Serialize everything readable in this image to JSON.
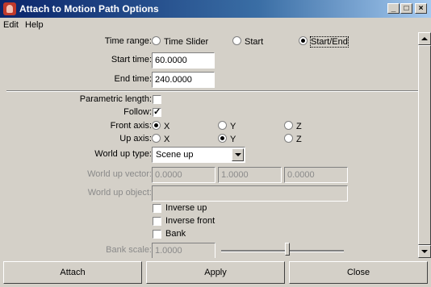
{
  "window": {
    "title": "Attach to Motion Path Options",
    "min_label": "_",
    "max_label": "□",
    "close_label": "×"
  },
  "menu": {
    "edit": "Edit",
    "help": "Help"
  },
  "time_range": {
    "label": "Time range:",
    "options": [
      "Time Slider",
      "Start",
      "Start/End"
    ],
    "selected": "Start/End"
  },
  "start_time": {
    "label": "Start time:",
    "value": "60.0000"
  },
  "end_time": {
    "label": "End time:",
    "value": "240.0000"
  },
  "parametric_length": {
    "label": "Parametric length:",
    "checked": false
  },
  "follow": {
    "label": "Follow:",
    "checked": true
  },
  "front_axis": {
    "label": "Front axis:",
    "options": [
      "X",
      "Y",
      "Z"
    ],
    "selected": "X"
  },
  "up_axis": {
    "label": "Up axis:",
    "options": [
      "X",
      "Y",
      "Z"
    ],
    "selected": "Y"
  },
  "world_up_type": {
    "label": "World up type:",
    "value": "Scene up"
  },
  "world_up_vector": {
    "label": "World up vector:",
    "values": [
      "0.0000",
      "1.0000",
      "0.0000"
    ]
  },
  "world_up_object": {
    "label": "World up object:",
    "value": ""
  },
  "inverse_up": {
    "label": "Inverse up",
    "checked": false
  },
  "inverse_front": {
    "label": "Inverse front",
    "checked": false
  },
  "bank": {
    "label": "Bank",
    "checked": false
  },
  "bank_scale": {
    "label": "Bank scale:",
    "value": "1.0000",
    "slider_fraction": 0.55
  },
  "buttons": {
    "attach": "Attach",
    "apply": "Apply",
    "close": "Close"
  }
}
